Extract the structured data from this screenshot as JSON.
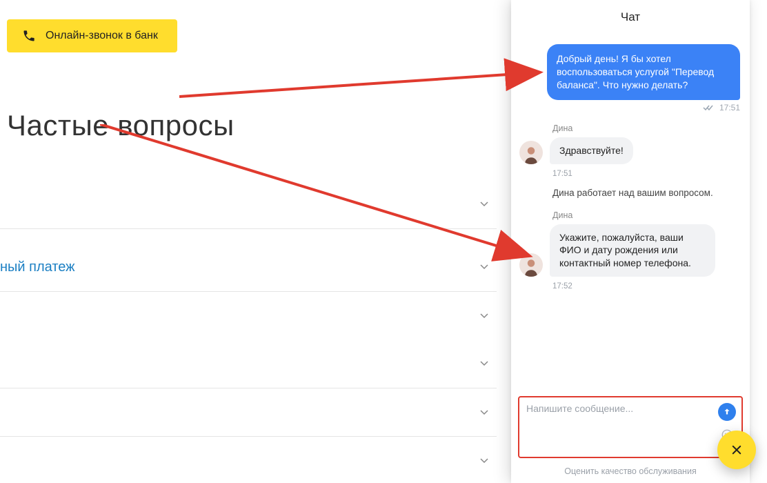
{
  "left": {
    "call_button_label": "Онлайн-звонок в банк",
    "heading": "Частые вопросы",
    "faq": [
      {
        "label": ""
      },
      {
        "label": "ный платеж",
        "is_link": true
      },
      {
        "label": ""
      },
      {
        "label": ""
      },
      {
        "label": ""
      },
      {
        "label": ""
      }
    ]
  },
  "chat": {
    "title": "Чат",
    "out": {
      "text": "Добрый день! Я бы хотел воспользоваться услугой \"Перевод баланса\". Что нужно делать?",
      "time": "17:51"
    },
    "agent_name": "Дина",
    "in1": {
      "text": "Здравствуйте!",
      "time": "17:51"
    },
    "system": "Дина работает над вашим вопросом.",
    "in2": {
      "text": "Укажите, пожалуйста, ваши ФИО и дату рождения или контактный номер телефона.",
      "time": "17:52"
    },
    "input_placeholder": "Напишите сообщение...",
    "rate_label": "Оценить качество обслуживания"
  }
}
